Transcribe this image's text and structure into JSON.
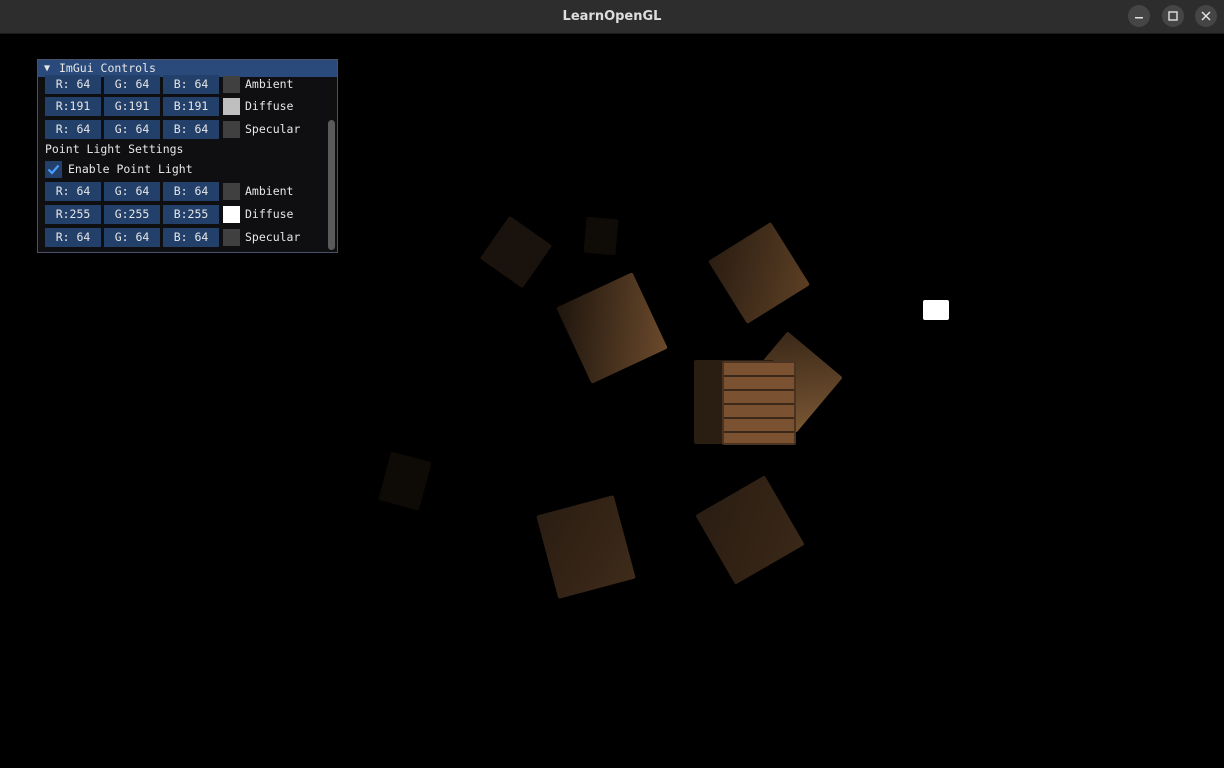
{
  "window": {
    "title": "LearnOpenGL",
    "buttons": [
      "minimize",
      "maximize",
      "close"
    ]
  },
  "panel": {
    "title": "ImGui Controls",
    "collapse_icon": "triangle-down-icon",
    "dir_rows": [
      {
        "r": "R: 64",
        "g": "G: 64",
        "b": "B: 64",
        "swatch": "#404040",
        "label": "Ambient"
      },
      {
        "r": "R:191",
        "g": "G:191",
        "b": "B:191",
        "swatch": "#bfbfbf",
        "label": "Diffuse"
      },
      {
        "r": "R: 64",
        "g": "G: 64",
        "b": "B: 64",
        "swatch": "#404040",
        "label": "Specular"
      }
    ],
    "point_section": "Point Light Settings",
    "enable_label": "Enable Point Light",
    "enable_checked": true,
    "point_rows": [
      {
        "r": "R: 64",
        "g": "G: 64",
        "b": "B: 64",
        "swatch": "#404040",
        "label": "Ambient"
      },
      {
        "r": "R:255",
        "g": "G:255",
        "b": "B:255",
        "swatch": "#ffffff",
        "label": "Diffuse"
      },
      {
        "r": "R: 64",
        "g": "G: 64",
        "b": "B: 64",
        "swatch": "#404040",
        "label": "Specular"
      }
    ]
  },
  "colors": {
    "accent": "#294a7a",
    "frame": "#23406a",
    "checkmark": "#4a9cff",
    "crate_dark": "#2a1d12",
    "crate_mid": "#6b4a2c",
    "light_cube": "#ffffff"
  }
}
